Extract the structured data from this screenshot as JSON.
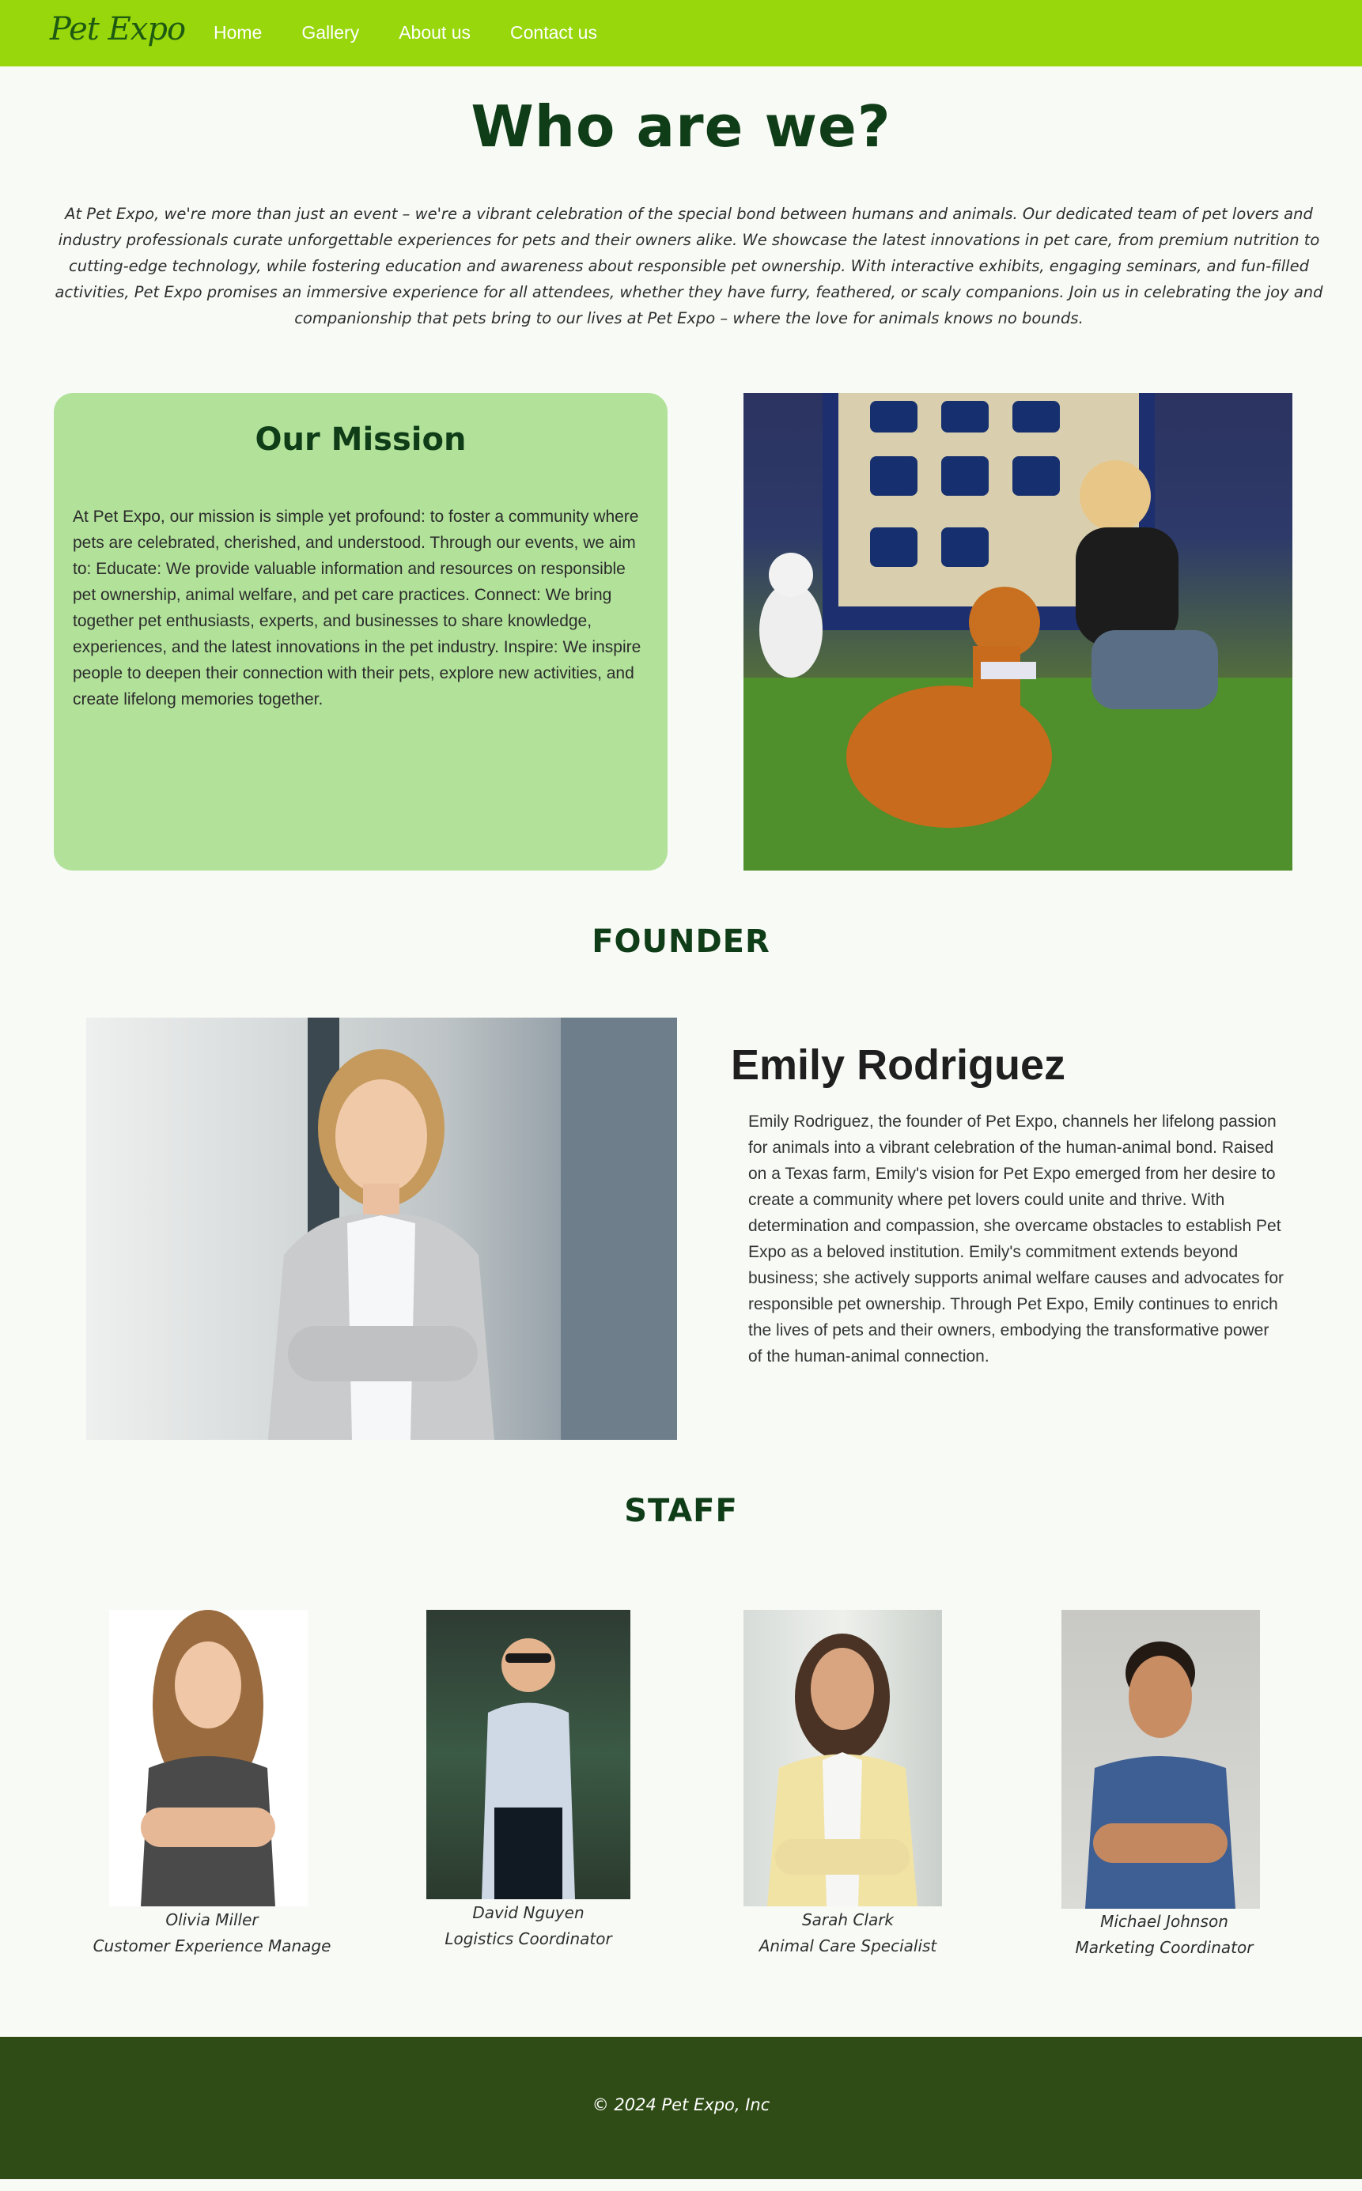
{
  "nav": {
    "logo": "Pet Expo",
    "links": [
      "Home",
      "Gallery",
      "About us",
      "Contact us"
    ]
  },
  "hero": {
    "title": "Who are we?",
    "intro": "At Pet Expo, we're more than just an event – we're a vibrant celebration of the special bond between humans and animals. Our dedicated team of pet lovers and industry professionals curate unforgettable experiences for pets and their owners alike. We showcase the latest innovations in pet care, from premium nutrition to cutting-edge technology, while fostering education and awareness about responsible pet ownership. With interactive exhibits, engaging seminars, and fun-filled activities, Pet Expo promises an immersive experience for all attendees, whether they have furry, feathered, or scaly companions. Join us in celebrating the joy and companionship that pets bring to our lives at Pet Expo – where the love for animals knows no bounds."
  },
  "mission": {
    "title": "Our Mission",
    "text": "At Pet Expo, our mission is simple yet profound: to foster a community where pets are celebrated, cherished, and understood. Through our events, we aim to: Educate: We provide valuable information and resources on responsible pet ownership, animal welfare, and pet care practices. Connect: We bring together pet enthusiasts, experts, and businesses to share knowledge, experiences, and the latest innovations in the pet industry. Inspire: We inspire people to deepen their connection with their pets, explore new activities, and create lifelong memories together."
  },
  "founder": {
    "section_title": "FOUNDER",
    "name": "Emily Rodriguez",
    "bio": "Emily Rodriguez, the founder of Pet Expo, channels her lifelong passion for animals into a vibrant celebration of the human-animal bond. Raised on a Texas farm, Emily's vision for Pet Expo emerged from her desire to create a community where pet lovers could unite and thrive. With determination and compassion, she overcame obstacles to establish Pet Expo as a beloved institution. Emily's commitment extends beyond business; she actively supports animal welfare causes and advocates for responsible pet ownership. Through Pet Expo, Emily continues to enrich the lives of pets and their owners, embodying the transformative power of the human-animal connection."
  },
  "staff": {
    "section_title": "STAFF",
    "members": [
      {
        "name": "Olivia Miller",
        "role": "Customer Experience Manage"
      },
      {
        "name": "David Nguyen",
        "role": "Logistics Coordinator"
      },
      {
        "name": "Sarah Clark",
        "role": "Animal Care Specialist"
      },
      {
        "name": "Michael Johnson",
        "role": "Marketing Coordinator"
      }
    ]
  },
  "footer": {
    "text": "© 2024 Pet Expo, Inc"
  },
  "colors": {
    "nav": "#97d70b",
    "mission_card": "#b2e29a",
    "heading": "#0f3d17",
    "footer": "#2f4c16"
  }
}
